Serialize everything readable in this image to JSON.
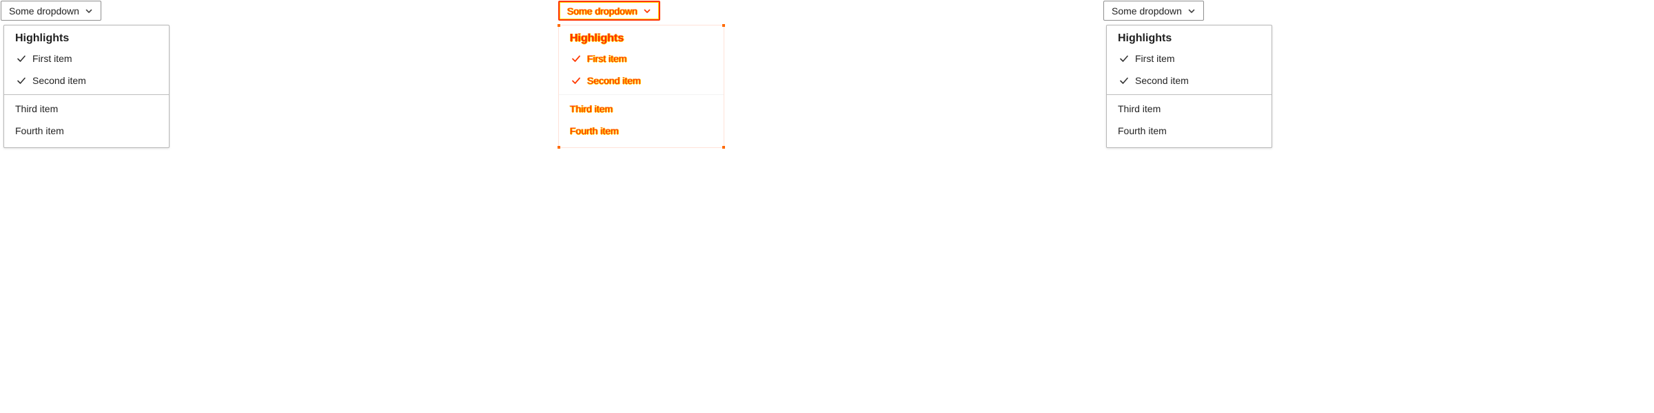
{
  "dropdown": {
    "trigger_label": "Some dropdown",
    "heading": "Highlights",
    "items": [
      {
        "label": "First item",
        "checked": true
      },
      {
        "label": "Second item",
        "checked": true
      },
      {
        "label": "Third item",
        "checked": false
      },
      {
        "label": "Fourth item",
        "checked": false
      }
    ]
  },
  "colors": {
    "diff_primary": "#ff2a00",
    "diff_secondary": "#ffd200"
  },
  "icons": {
    "trigger": "chevron-down-icon",
    "checked_item": "check-icon"
  }
}
